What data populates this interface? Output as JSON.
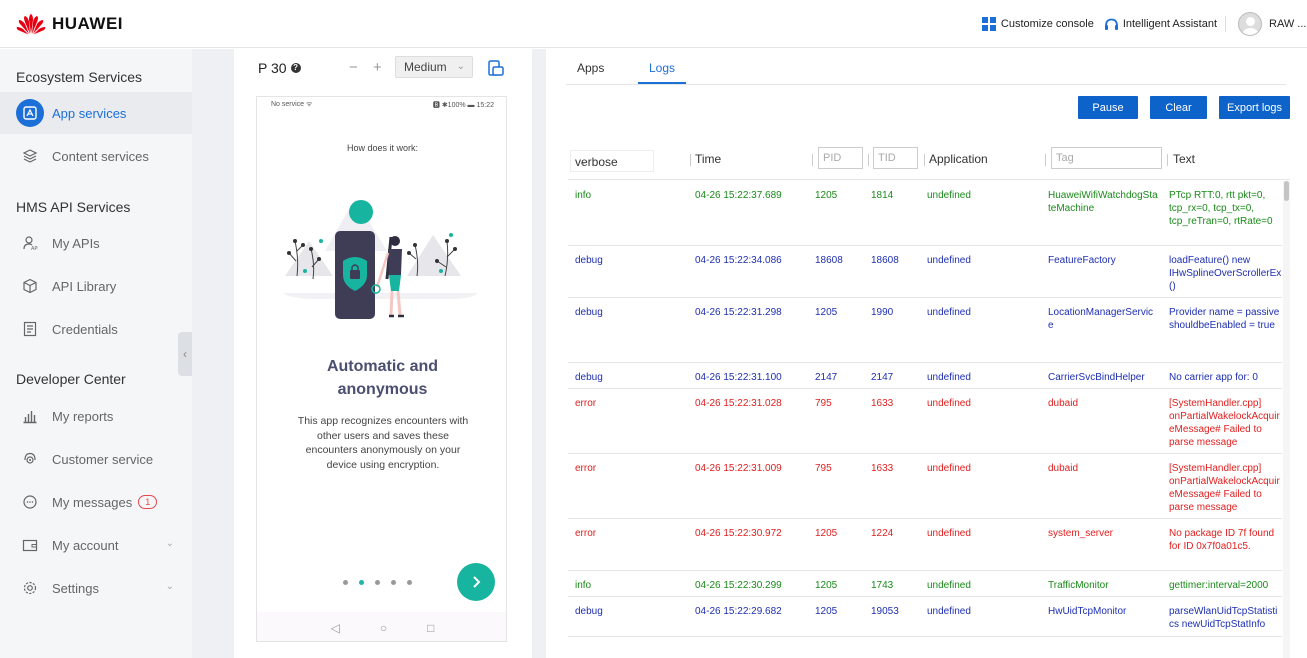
{
  "header": {
    "brand": "HUAWEI",
    "customize_console": "Customize console",
    "intelligent_assistant": "Intelligent Assistant",
    "user_name": "RAW ..."
  },
  "sidebar": {
    "section_ecosystem": "Ecosystem Services",
    "app_services": "App services",
    "content_services": "Content services",
    "section_hms": "HMS API Services",
    "my_apis": "My APIs",
    "api_library": "API Library",
    "credentials": "Credentials",
    "section_developer": "Developer Center",
    "my_reports": "My reports",
    "customer_service": "Customer service",
    "my_messages": "My messages",
    "messages_badge": "1",
    "my_account": "My account",
    "settings": "Settings"
  },
  "device": {
    "model": "P 30",
    "zoom_out": "−",
    "zoom_in": "+",
    "size": "Medium",
    "status_left": "No service ᯤ",
    "status_right": "🅱 ✱100% ▬ 15:22",
    "how_it_works": "How does it work:",
    "title_line1": "Automatic and",
    "title_line2": "anonymous",
    "description": "This app recognizes encounters with other users and saves these encounters anonymously on your device using encryption."
  },
  "logs": {
    "tab_apps": "Apps",
    "tab_logs": "Logs",
    "pause": "Pause",
    "clear": "Clear",
    "export": "Export logs",
    "level_value": "verbose",
    "col_time": "Time",
    "pid_placeholder": "PID",
    "tid_placeholder": "TID",
    "col_application": "Application",
    "tag_placeholder": "Tag",
    "col_text": "Text",
    "rows": [
      {
        "level": "info",
        "time": "04-26 15:22:37.689",
        "pid": "1205",
        "tid": "1814",
        "app": "undefined",
        "tag": "HuaweiWifiWatchdogStateMachine",
        "text": "PTcp RTT:0, rtt pkt=0, tcp_rx=0, tcp_tx=0, tcp_reTran=0, rtRate=0"
      },
      {
        "level": "debug",
        "time": "04-26 15:22:34.086",
        "pid": "18608",
        "tid": "18608",
        "app": "undefined",
        "tag": "FeatureFactory",
        "text": "loadFeature() new IHwSplineOverScrollerEx()"
      },
      {
        "level": "debug",
        "time": "04-26 15:22:31.298",
        "pid": "1205",
        "tid": "1990",
        "app": "undefined",
        "tag": "LocationManagerService",
        "text": "Provider name = passive shouldbeEnabled = true"
      },
      {
        "level": "debug",
        "time": "04-26 15:22:31.100",
        "pid": "2147",
        "tid": "2147",
        "app": "undefined",
        "tag": "CarrierSvcBindHelper",
        "text": "No carrier app for: 0"
      },
      {
        "level": "error",
        "time": "04-26 15:22:31.028",
        "pid": "795",
        "tid": "1633",
        "app": "undefined",
        "tag": "dubaid",
        "text": "[SystemHandler.cpp] onPartialWakelockAcquireMessage# Failed to parse message"
      },
      {
        "level": "error",
        "time": "04-26 15:22:31.009",
        "pid": "795",
        "tid": "1633",
        "app": "undefined",
        "tag": "dubaid",
        "text": "[SystemHandler.cpp] onPartialWakelockAcquireMessage# Failed to parse message"
      },
      {
        "level": "error",
        "time": "04-26 15:22:30.972",
        "pid": "1205",
        "tid": "1224",
        "app": "undefined",
        "tag": "system_server",
        "text": "No package ID 7f found for ID 0x7f0a01c5."
      },
      {
        "level": "info",
        "time": "04-26 15:22:30.299",
        "pid": "1205",
        "tid": "1743",
        "app": "undefined",
        "tag": "TrafficMonitor",
        "text": "gettimer:interval=2000"
      },
      {
        "level": "debug",
        "time": "04-26 15:22:29.682",
        "pid": "1205",
        "tid": "19053",
        "app": "undefined",
        "tag": "HwUidTcpMonitor",
        "text": "parseWlanUidTcpStatistics newUidTcpStatInfo"
      }
    ]
  }
}
